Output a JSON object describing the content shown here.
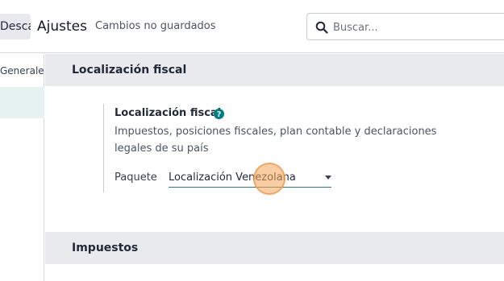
{
  "topbar": {
    "discard_label": "Descartar",
    "page_title": "Ajustes",
    "unsaved_status": "Cambios no guardados",
    "search": {
      "placeholder": "Buscar..."
    }
  },
  "sidebar": {
    "items": [
      {
        "label": "Generales"
      },
      {
        "label": ""
      }
    ]
  },
  "main": {
    "sections": [
      {
        "title": "Localización fiscal"
      },
      {
        "title": "Impuestos"
      }
    ],
    "fiscal_setting": {
      "title": "Localización fiscal",
      "description": "Impuestos, posiciones fiscales, plan contable y declaraciones legales de su país",
      "package_label": "Paquete",
      "package_value": "Localización Venezolana"
    }
  },
  "colors": {
    "accent": "#2a7a7a",
    "help_icon": "#017e84",
    "section_header_bg": "#e9eaed",
    "sidebar_selected_bg": "#e6f2f2",
    "cursor_highlight": "#f5a65a"
  },
  "icons": {
    "search": "magnifier-icon",
    "help": "question-circle-icon",
    "dropdown": "caret-down-icon"
  }
}
